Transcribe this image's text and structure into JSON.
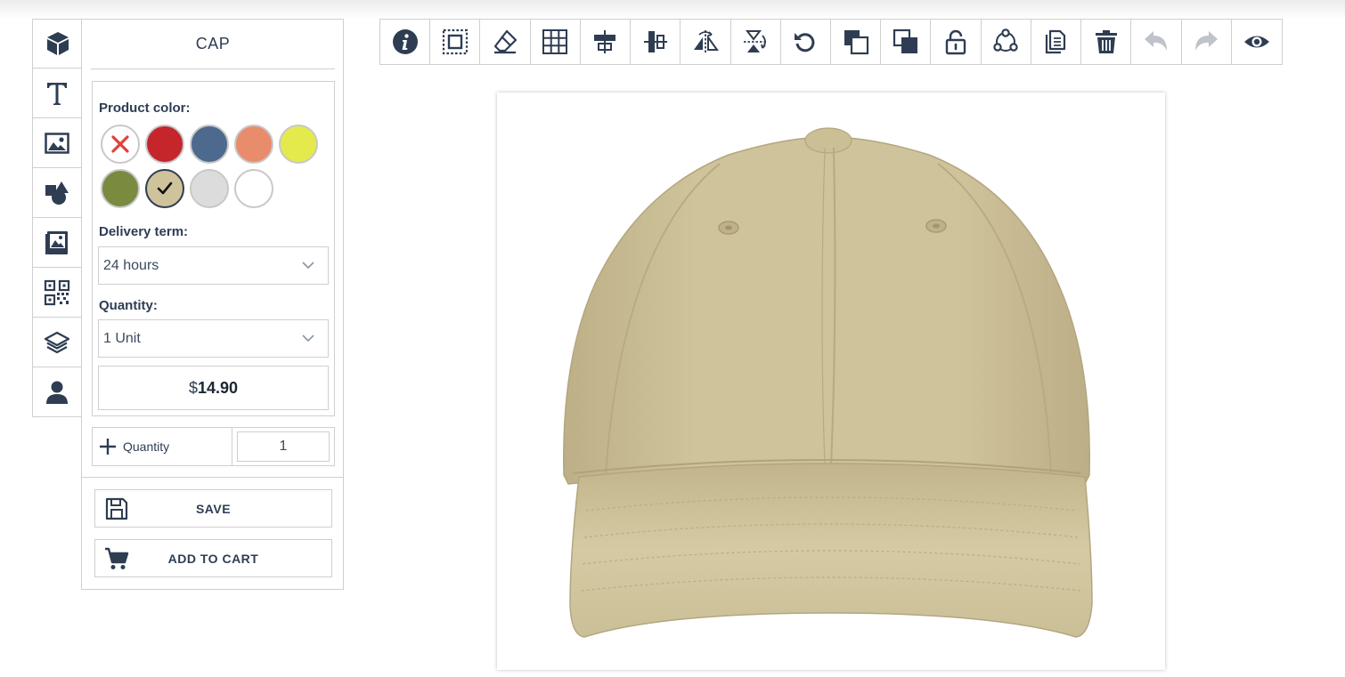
{
  "product": {
    "title": "CAP"
  },
  "options": {
    "color_label": "Product color:",
    "colors": [
      {
        "name": "none",
        "hex": "#ffffff",
        "selected": false
      },
      {
        "name": "red",
        "hex": "#c4262b",
        "selected": false
      },
      {
        "name": "slate-blue",
        "hex": "#4d6a8e",
        "selected": false
      },
      {
        "name": "salmon",
        "hex": "#e98c6c",
        "selected": false
      },
      {
        "name": "yellow",
        "hex": "#e4ea4b",
        "selected": false
      },
      {
        "name": "olive",
        "hex": "#7a8a3e",
        "selected": false
      },
      {
        "name": "khaki",
        "hex": "#cfc39b",
        "selected": true
      },
      {
        "name": "light-gray",
        "hex": "#dcdcdc",
        "selected": false
      },
      {
        "name": "white",
        "hex": "#ffffff",
        "selected": false
      }
    ],
    "delivery_label": "Delivery term:",
    "delivery_value": "24 hours",
    "quantity_label": "Quantity:",
    "quantity_value": "1 Unit",
    "price_currency": "$",
    "price_amount": "14.90"
  },
  "quantity_row": {
    "button_label": "Quantity",
    "value": "1"
  },
  "actions": {
    "save_label": "SAVE",
    "add_to_cart_label": "ADD TO CART"
  },
  "rail_icons": [
    "product-cube-icon",
    "text-icon",
    "image-icon",
    "shapes-icon",
    "gallery-icon",
    "qr-code-icon",
    "layers-icon",
    "user-icon"
  ],
  "toolbar_icons": [
    "info-icon",
    "select-all-icon",
    "eraser-icon",
    "grid-icon",
    "align-horizontal-center-icon",
    "align-vertical-center-icon",
    "flip-horizontal-icon",
    "flip-vertical-icon",
    "rotate-icon",
    "bring-forward-icon",
    "send-backward-icon",
    "lock-icon",
    "group-icon",
    "duplicate-icon",
    "delete-icon",
    "undo-icon",
    "redo-icon",
    "preview-icon"
  ],
  "theme": {
    "icon_color": "#2e3d52",
    "border_color": "#cfcfcf",
    "cap_color": "#cfc39b"
  }
}
